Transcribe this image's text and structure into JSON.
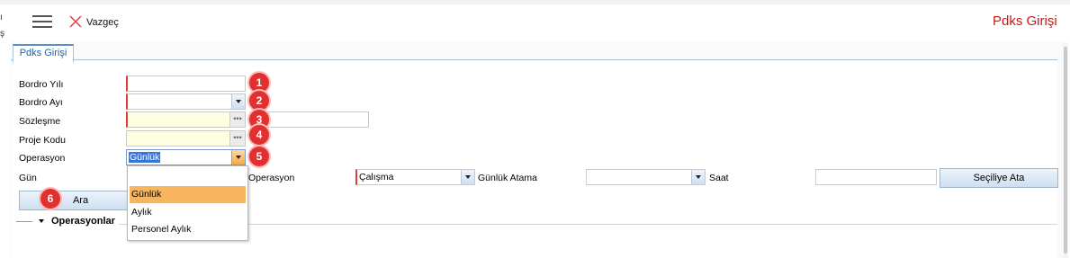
{
  "toolbar": {
    "cancel_label": "Vazgeç"
  },
  "page": {
    "title": "Pdks Girişi"
  },
  "tabs": [
    {
      "label": "Pdks Girişi",
      "active": true
    }
  ],
  "form": {
    "bordro_yili": {
      "label": "Bordro Yılı",
      "value": "",
      "badge": "1"
    },
    "bordro_ayi": {
      "label": "Bordro Ayı",
      "value": "",
      "badge": "2"
    },
    "sozlesme": {
      "label": "Sözleşme",
      "value": "",
      "badge": "3"
    },
    "proje_kodu": {
      "label": "Proje Kodu",
      "value": "",
      "badge": "4"
    },
    "operasyon": {
      "label": "Operasyon",
      "value": "Günlük",
      "badge": "5"
    }
  },
  "row_gun": {
    "gun_label": "Gün",
    "operasyon_label": "Operasyon",
    "operasyon_value": "Çalışma",
    "gunluk_atama_label": "Günlük Atama",
    "gunluk_atama_value": "",
    "saat_label": "Saat",
    "saat_value": "",
    "apply_button": "Seçiliye Ata"
  },
  "search_button": {
    "label": "Ara",
    "badge": "6"
  },
  "dropdown_options": [
    {
      "label": "",
      "selected": false
    },
    {
      "label": "Günlük",
      "selected": true
    },
    {
      "label": "Aylık",
      "selected": false
    },
    {
      "label": "Personel Aylık",
      "selected": false
    }
  ],
  "section": {
    "title": "Operasyonlar"
  },
  "left_edge_chars": [
    "ı",
    "ş"
  ],
  "colors": {
    "title_red": "#d21414",
    "badge_red": "#e0302f",
    "required_border": "#e53b3b",
    "lookup_yellow": "#fffde0",
    "selected_option": "#f8b55d",
    "tab_blue": "#1f5f9f"
  },
  "icons": [
    "menu-icon",
    "close-icon",
    "dropdown-arrow-icon",
    "ellipsis-icon",
    "collapse-triangle-icon"
  ]
}
